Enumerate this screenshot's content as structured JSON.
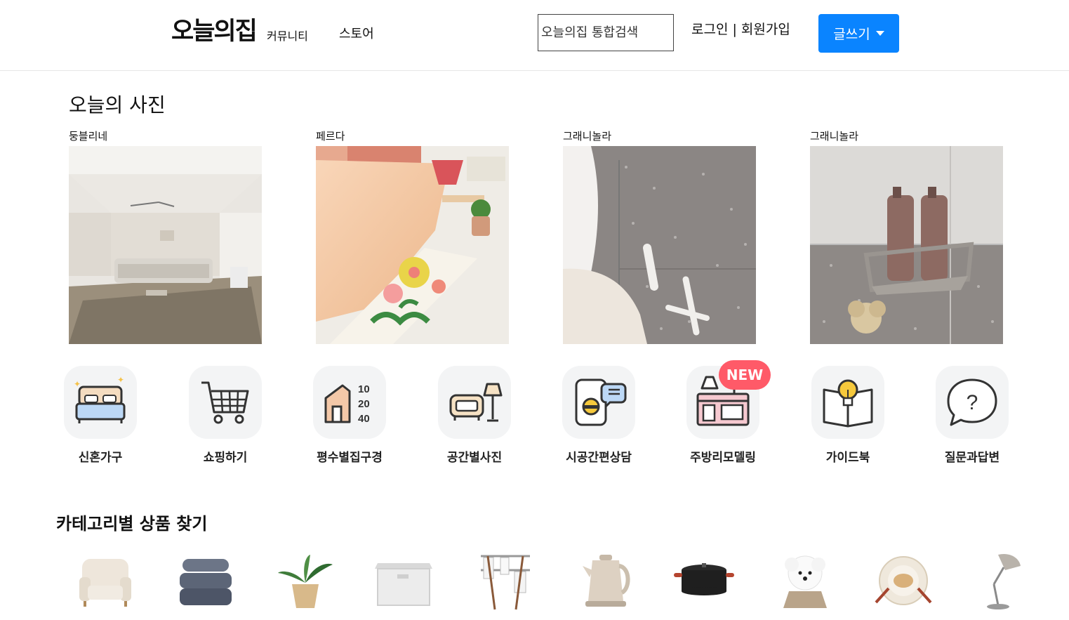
{
  "header": {
    "logo": "오늘의집",
    "nav": [
      "커뮤니티",
      "스토어"
    ],
    "search_placeholder": "오늘의집 통합검색",
    "auth_text": "로그인 | 회원가입",
    "write_label": "글쓰기"
  },
  "photos": {
    "title": "오늘의 사진",
    "items": [
      {
        "author": "둥블리네"
      },
      {
        "author": "페르다"
      },
      {
        "author": "그래니놀라"
      },
      {
        "author": "그래니놀라"
      }
    ]
  },
  "quick_menu": {
    "badge": "NEW",
    "items": [
      {
        "label": "신혼가구",
        "icon": "bed-icon"
      },
      {
        "label": "쇼핑하기",
        "icon": "cart-icon"
      },
      {
        "label": "평수별집구경",
        "icon": "house-size-icon",
        "numbers": [
          "10",
          "20",
          "40"
        ]
      },
      {
        "label": "공간별사진",
        "icon": "sofa-lamp-icon"
      },
      {
        "label": "시공간편상담",
        "icon": "consult-phone-icon"
      },
      {
        "label": "주방리모델링",
        "icon": "kitchen-icon"
      },
      {
        "label": "가이드북",
        "icon": "guidebook-icon"
      },
      {
        "label": "질문과답변",
        "icon": "question-bubble-icon",
        "glyph": "?"
      }
    ]
  },
  "categories": {
    "title": "카테고리별 상품 찾기",
    "items": [
      {
        "icon": "armchair-icon"
      },
      {
        "icon": "bedding-icon"
      },
      {
        "icon": "plant-icon"
      },
      {
        "icon": "storage-box-icon"
      },
      {
        "icon": "drying-rack-icon"
      },
      {
        "icon": "kettle-icon"
      },
      {
        "icon": "pot-icon"
      },
      {
        "icon": "pet-dog-icon"
      },
      {
        "icon": "tableware-icon"
      },
      {
        "icon": "desk-lamp-icon"
      }
    ]
  }
}
